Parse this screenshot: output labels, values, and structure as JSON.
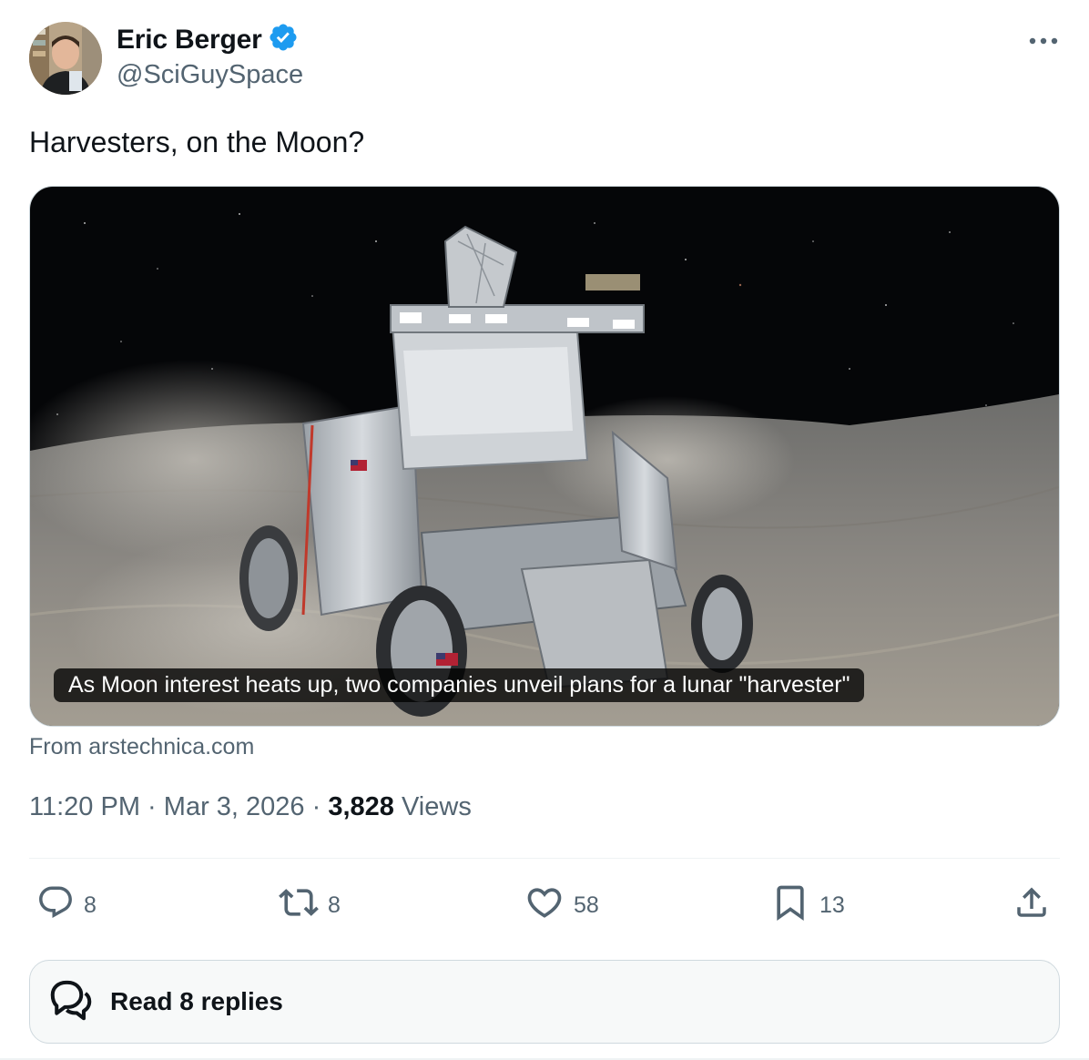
{
  "author": {
    "display_name": "Eric Berger",
    "handle": "@SciGuySpace",
    "verified_icon": "verified-badge-icon",
    "verified_color": "#1d9bf0",
    "avatar_icon": "profile-avatar"
  },
  "more_icon": "more-horizontal-icon",
  "tweet": {
    "text": "Harvesters, on the Moon?"
  },
  "link_card": {
    "caption": "As Moon interest heats up, two companies unveil plans for a lunar \"harvester\"",
    "source": "From arstechnica.com",
    "image_icon": "lunar-harvester-image"
  },
  "meta": {
    "time": "11:20 PM",
    "separator": "·",
    "date": "Mar 3, 2026",
    "views_count": "3,828",
    "views_label": "Views"
  },
  "actions": {
    "reply": {
      "icon": "reply-icon",
      "count": "8"
    },
    "repost": {
      "icon": "repost-icon",
      "count": "8"
    },
    "like": {
      "icon": "heart-icon",
      "count": "58"
    },
    "bookmark": {
      "icon": "bookmark-icon",
      "count": "13"
    },
    "share": {
      "icon": "share-icon"
    }
  },
  "read_replies": {
    "icon": "chat-bubbles-icon",
    "label": "Read 8 replies"
  },
  "colors": {
    "text_primary": "#0f1419",
    "text_secondary": "#536471",
    "border": "#cfd9de",
    "divider": "#eff3f4",
    "button_bg": "#f7f9f9"
  }
}
